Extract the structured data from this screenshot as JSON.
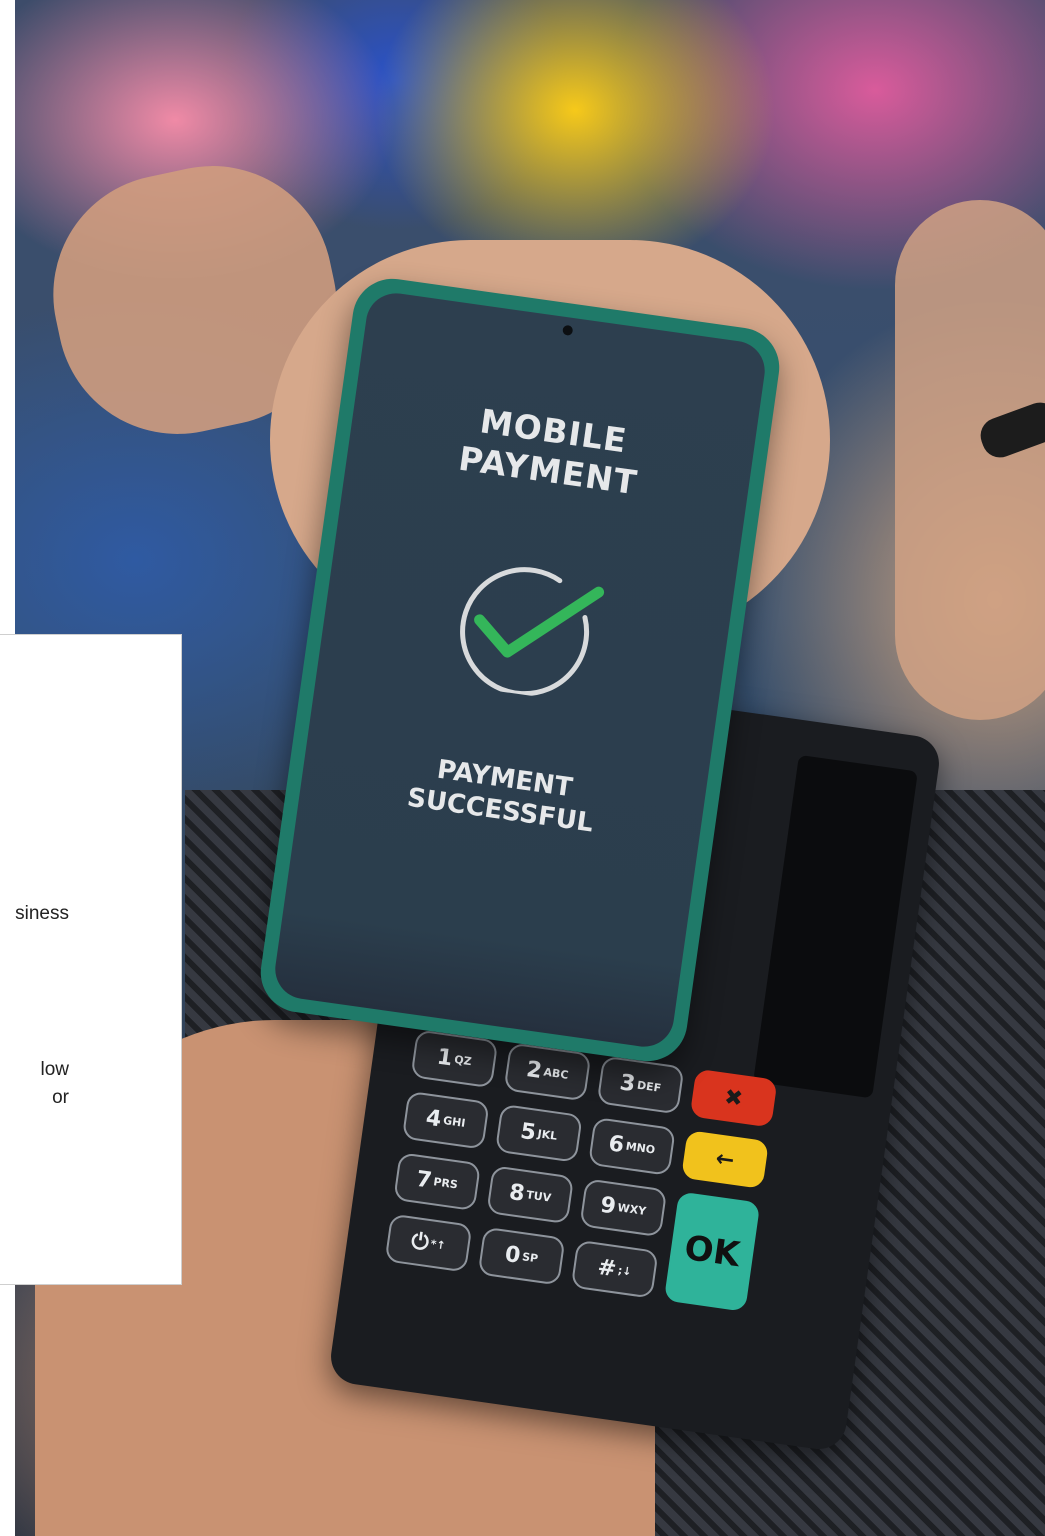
{
  "phone_screen": {
    "title_line1": "MOBILE",
    "title_line2": "PAYMENT",
    "status_line1": "PAYMENT",
    "status_line2": "SUCCESSFUL",
    "icon": "check-circle-icon",
    "check_color": "#34b65a"
  },
  "overlay_card": {
    "line1": "siness",
    "line2": "low",
    "line3": "or"
  },
  "keypad": [
    {
      "digit": "1",
      "letters": "QZ"
    },
    {
      "digit": "2",
      "letters": "ABC"
    },
    {
      "digit": "3",
      "letters": "DEF"
    },
    {
      "digit": "✖",
      "letters": ""
    },
    {
      "digit": "4",
      "letters": "GHI"
    },
    {
      "digit": "5",
      "letters": "JKL"
    },
    {
      "digit": "6",
      "letters": "MNO"
    },
    {
      "digit": "←",
      "letters": ""
    },
    {
      "digit": "7",
      "letters": "PRS"
    },
    {
      "digit": "8",
      "letters": "TUV"
    },
    {
      "digit": "9",
      "letters": "WXY"
    },
    {
      "digit": "OK",
      "letters": ""
    },
    {
      "digit": "⏻",
      "letters": "*↑"
    },
    {
      "digit": "0",
      "letters": "SP"
    },
    {
      "digit": "#",
      "letters": ";↓"
    }
  ]
}
